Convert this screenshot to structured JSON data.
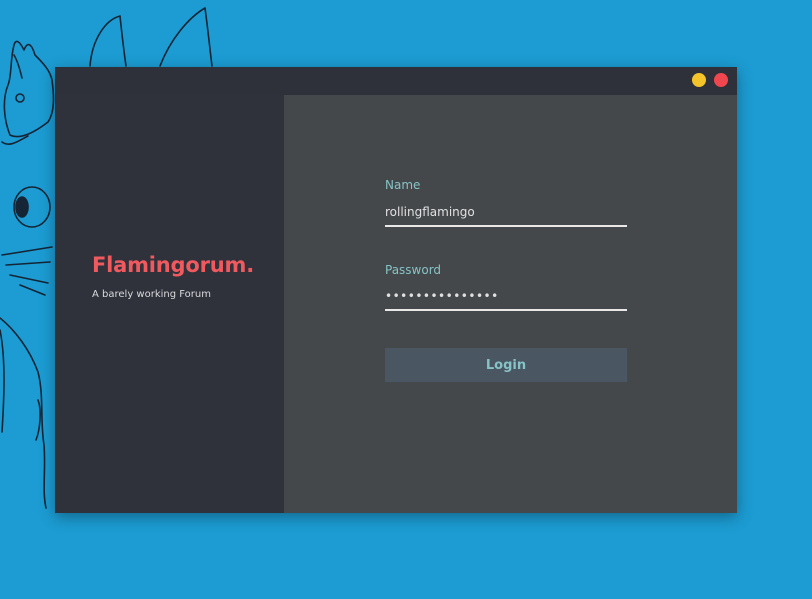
{
  "colors": {
    "desktop_background": "#1c9cd3",
    "brand_accent": "#f05a5f",
    "label_accent": "#86c3c6",
    "minimize_button": "#f5c32a",
    "close_button": "#f0474f",
    "login_button_background": "#4a5762",
    "login_button_text": "#86c3c6"
  },
  "window": {
    "controls": [
      {
        "name": "minimize",
        "icon": "minimize-dot-icon"
      },
      {
        "name": "close",
        "icon": "close-dot-icon"
      }
    ]
  },
  "sidebar": {
    "title": "Flamingorum.",
    "subtitle": "A barely working Forum"
  },
  "form": {
    "name_label": "Name",
    "name_value": "rollingflamingo",
    "password_label": "Password",
    "password_value": "•••••••••••••••",
    "login_label": "Login"
  }
}
